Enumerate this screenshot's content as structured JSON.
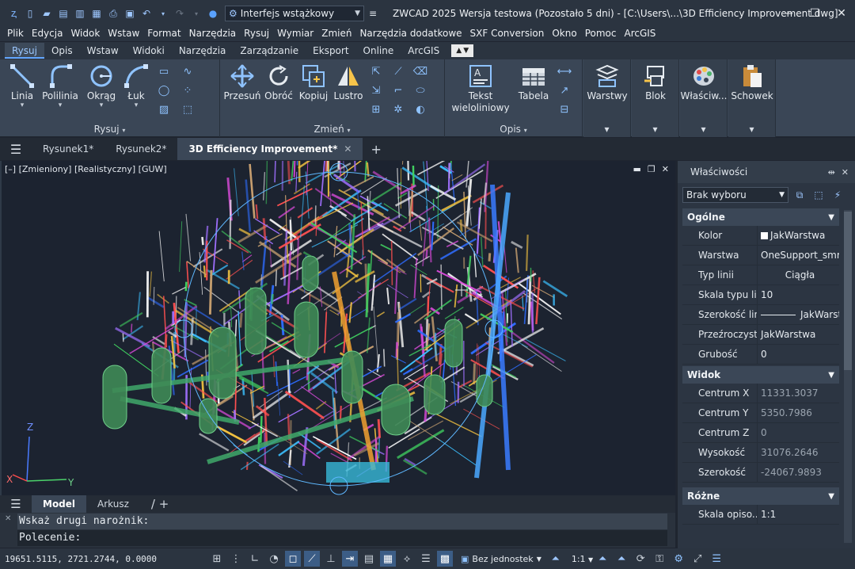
{
  "titlebar": {
    "workspace": "Interfejs wstążkowy",
    "title": "ZWCAD 2025 Wersja testowa (Pozostało 5 dni) - [C:\\Users\\...\\3D Efficiency Improvement.dwg]"
  },
  "menubar": [
    "Plik",
    "Edycja",
    "Widok",
    "Wstaw",
    "Format",
    "Narzędzia",
    "Rysuj",
    "Wymiar",
    "Zmień",
    "Narzędzia dodatkowe",
    "SXF Conversion",
    "Okno",
    "Pomoc",
    "ArcGIS"
  ],
  "ribbon_tabs": [
    "Rysuj",
    "Opis",
    "Wstaw",
    "Widoki",
    "Narzędzia",
    "Zarządzanie",
    "Eksport",
    "Online",
    "ArcGIS"
  ],
  "ribbon": {
    "draw": {
      "label": "Rysuj",
      "line": "Linia",
      "polyline": "Polilinia",
      "circle": "Okrąg",
      "arc": "Łuk"
    },
    "modify": {
      "label": "Zmień",
      "move": "Przesuń",
      "rotate": "Obróć",
      "copy": "Kopiuj",
      "mirror": "Lustro"
    },
    "annotate": {
      "label": "Opis",
      "mtext_1": "Tekst",
      "mtext_2": "wieloliniowy",
      "table": "Tabela"
    },
    "layers": "Warstwy",
    "block": "Blok",
    "properties": "Właściw...",
    "clipboard": "Schowek"
  },
  "doc_tabs": [
    "Rysunek1*",
    "Rysunek2*",
    "3D Efficiency Improvement*"
  ],
  "viewport": {
    "label": "[–] [Zmieniony] [Realistyczny] [GUW]",
    "axis_x": "X",
    "axis_y": "Y",
    "axis_z": "Z"
  },
  "layout_tabs": [
    "Model",
    "Arkusz"
  ],
  "command": {
    "history": "Wskaż drugi narożnik:",
    "prompt": "Polecenie:"
  },
  "statusbar": {
    "coords": "19651.5115, 2721.2744, 0.0000",
    "units": "Bez jednostek",
    "scale": "1:1"
  },
  "properties": {
    "title": "Właściwości",
    "selection": "Brak wyboru",
    "sections": {
      "general": {
        "title": "Ogólne",
        "rows": [
          {
            "name": "Kolor",
            "value": "JakWarstwa"
          },
          {
            "name": "Warstwa",
            "value": "OneSupport_smrtln"
          },
          {
            "name": "Typ linii",
            "value": "Ciągła"
          },
          {
            "name": "Skala typu li...",
            "value": "10"
          },
          {
            "name": "Szerokość linii",
            "value": "JakWarstwa"
          },
          {
            "name": "Przeźroczyst...",
            "value": "JakWarstwa"
          },
          {
            "name": "Grubość",
            "value": "0"
          }
        ]
      },
      "view": {
        "title": "Widok",
        "rows": [
          {
            "name": "Centrum X",
            "value": "11331.3037"
          },
          {
            "name": "Centrum Y",
            "value": "5350.7986"
          },
          {
            "name": "Centrum Z",
            "value": "0"
          },
          {
            "name": "Wysokość",
            "value": "31076.2646"
          },
          {
            "name": "Szerokość",
            "value": "-24067.9893"
          }
        ]
      },
      "misc": {
        "title": "Różne",
        "rows": [
          {
            "name": "Skala opiso...",
            "value": "1:1"
          }
        ]
      }
    }
  },
  "colors": {
    "accent": "#62a6ff",
    "viewport_bg": "#1c2330",
    "orbit": "#6fc3ff"
  }
}
